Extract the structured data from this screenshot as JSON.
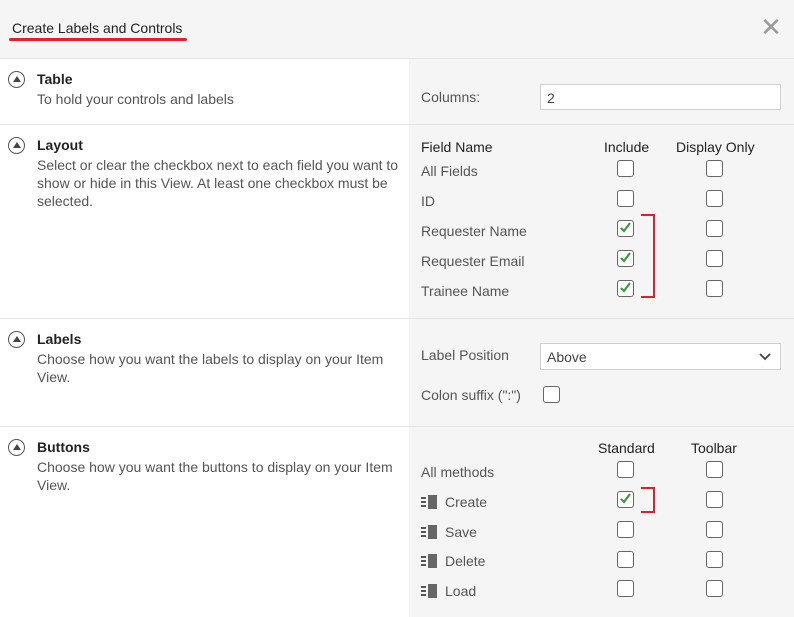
{
  "dialog": {
    "title": "Create Labels and Controls",
    "close_glyph": "✕"
  },
  "sections": {
    "table": {
      "title": "Table",
      "description": "To hold your controls and labels",
      "columns_label": "Columns:",
      "columns_value": "2"
    },
    "layout": {
      "title": "Layout",
      "description": "Select or clear the checkbox next to each field you want to show or hide in this View. At least one checkbox must be selected.",
      "headers": {
        "field_name": "Field Name",
        "include": "Include",
        "display_only": "Display Only"
      },
      "fields": [
        {
          "name": "All Fields",
          "include": false,
          "display_only": false
        },
        {
          "name": "ID",
          "include": false,
          "display_only": false
        },
        {
          "name": "Requester Name",
          "include": true,
          "display_only": false
        },
        {
          "name": "Requester Email",
          "include": true,
          "display_only": false
        },
        {
          "name": "Trainee Name",
          "include": true,
          "display_only": false
        }
      ]
    },
    "labels": {
      "title": "Labels",
      "description": "Choose how you want the labels to display on your Item View.",
      "label_position_label": "Label Position",
      "label_position_value": "Above",
      "colon_suffix_label": "Colon suffix (\":\")",
      "colon_suffix_checked": false
    },
    "buttons": {
      "title": "Buttons",
      "description": "Choose how you want the buttons to display on your Item View.",
      "headers": {
        "standard": "Standard",
        "toolbar": "Toolbar"
      },
      "all_methods_label": "All methods",
      "methods": [
        {
          "name": "Create",
          "standard": true,
          "toolbar": false
        },
        {
          "name": "Save",
          "standard": false,
          "toolbar": false
        },
        {
          "name": "Delete",
          "standard": false,
          "toolbar": false
        },
        {
          "name": "Load",
          "standard": false,
          "toolbar": false
        }
      ]
    }
  },
  "colors": {
    "accent_red": "#e0212a",
    "check_green": "#3a9a3a"
  }
}
